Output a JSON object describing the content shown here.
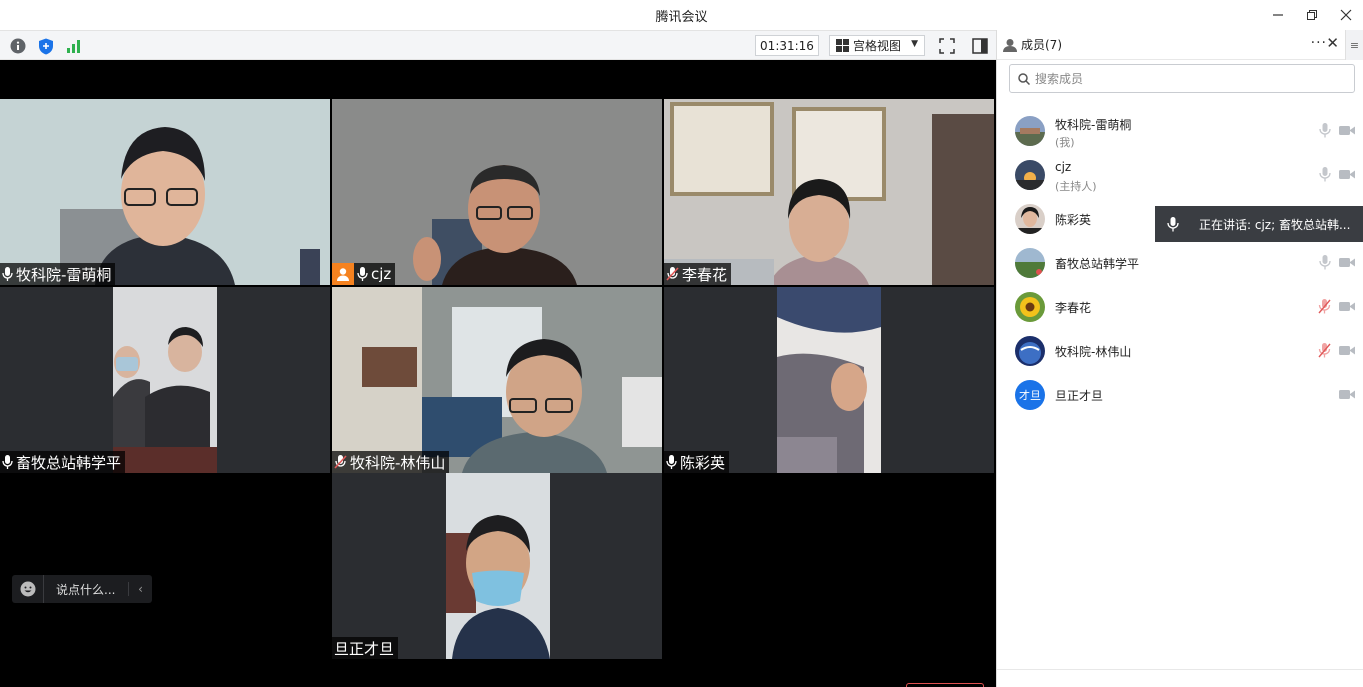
{
  "window": {
    "title": "腾讯会议"
  },
  "toolbar": {
    "timer": "01:31:16",
    "view_label": "宫格视图",
    "icons": [
      "info-icon",
      "shield-icon",
      "signal-icon",
      "fullscreen-icon",
      "sidebar-toggle-icon"
    ]
  },
  "tiles": [
    {
      "name": "牧科院-雷萌桐",
      "mic": "on",
      "host": false,
      "active": false
    },
    {
      "name": "cjz",
      "mic": "on",
      "host": true,
      "active": true
    },
    {
      "name": "李春花",
      "mic": "off",
      "host": false,
      "active": false
    },
    {
      "name": "畜牧总站韩学平",
      "mic": "on",
      "host": false,
      "active": false
    },
    {
      "name": "牧科院-林伟山",
      "mic": "off",
      "host": false,
      "active": false
    },
    {
      "name": "陈彩英",
      "mic": "on",
      "host": false,
      "active": false
    },
    {
      "name": "旦正才旦",
      "mic": "none",
      "host": false,
      "active": false
    }
  ],
  "chat": {
    "placeholder": "说点什么..."
  },
  "panel": {
    "title": "成员(7)",
    "search_placeholder": "搜索成员",
    "speaking": "正在讲话: cjz; 畜牧总站韩...",
    "members": [
      {
        "name": "牧科院-雷萌桐",
        "sub": "(我)",
        "avatar": "avatar-landscape",
        "mic": "on"
      },
      {
        "name": "cjz",
        "sub": "(主持人)",
        "avatar": "avatar-sunset",
        "mic": "on"
      },
      {
        "name": "陈彩英",
        "sub": "",
        "avatar": "avatar-woman",
        "mic": "on"
      },
      {
        "name": "畜牧总站韩学平",
        "sub": "",
        "avatar": "avatar-field",
        "mic": "on"
      },
      {
        "name": "李春花",
        "sub": "",
        "avatar": "avatar-sunflower",
        "mic": "off"
      },
      {
        "name": "牧科院-林伟山",
        "sub": "",
        "avatar": "avatar-earth",
        "mic": "off"
      },
      {
        "name": "旦正才旦",
        "sub": "",
        "avatar_text": "才旦",
        "mic": "none"
      }
    ]
  },
  "colors": {
    "accent": "#1a73e8",
    "active_border": "#2fb14f",
    "host_badge": "#f5821f",
    "muted": "#e05a5a"
  }
}
